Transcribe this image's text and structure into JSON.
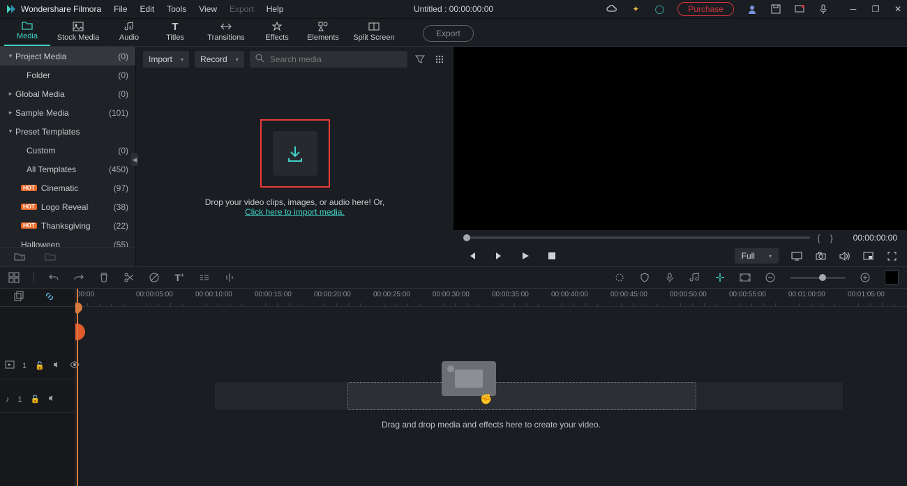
{
  "app": {
    "name": "Wondershare Filmora",
    "title": "Untitled : 00:00:00:00"
  },
  "menu": {
    "file": "File",
    "edit": "Edit",
    "tools": "Tools",
    "view": "View",
    "export": "Export",
    "help": "Help"
  },
  "titlebar": {
    "purchase": "Purchase"
  },
  "modules": {
    "media": "Media",
    "stock": "Stock Media",
    "audio": "Audio",
    "titles": "Titles",
    "transitions": "Transitions",
    "effects": "Effects",
    "elements": "Elements",
    "split": "Split Screen",
    "export": "Export"
  },
  "tree": [
    {
      "label": "Project Media",
      "count": "(0)",
      "sel": true,
      "caret": "▾",
      "ind": 0
    },
    {
      "label": "Folder",
      "count": "(0)",
      "ind": 1
    },
    {
      "label": "Global Media",
      "count": "(0)",
      "caret": "▸",
      "ind": 0
    },
    {
      "label": "Sample Media",
      "count": "(101)",
      "caret": "▸",
      "ind": 0
    },
    {
      "label": "Preset Templates",
      "count": "",
      "caret": "▾",
      "ind": 0
    },
    {
      "label": "Custom",
      "count": "(0)",
      "ind": 1
    },
    {
      "label": "All Templates",
      "count": "(450)",
      "ind": 1
    },
    {
      "label": "Cinematic",
      "count": "(97)",
      "hot": true,
      "ind": 2
    },
    {
      "label": "Logo Reveal",
      "count": "(38)",
      "hot": true,
      "ind": 2
    },
    {
      "label": "Thanksgiving",
      "count": "(22)",
      "hot": true,
      "ind": 2
    },
    {
      "label": "Halloween",
      "count": "(55)",
      "ind": 2
    }
  ],
  "midbar": {
    "import": "Import",
    "record": "Record",
    "search_ph": "Search media"
  },
  "drop": {
    "text": "Drop your video clips, images, or audio here! Or,",
    "link": "Click here to import media."
  },
  "preview": {
    "timecode": "00:00:00:00",
    "quality": "Full",
    "brace_l": "{",
    "brace_r": "}"
  },
  "ruler": [
    "00:00",
    "00:00:05:00",
    "00:00:10:00",
    "00:00:15:00",
    "00:00:20:00",
    "00:00:25:00",
    "00:00:30:00",
    "00:00:35:00",
    "00:00:40:00",
    "00:00:45:00",
    "00:00:50:00",
    "00:00:55:00",
    "00:01:00:00",
    "00:01:05:00",
    "00:01:"
  ],
  "timeline": {
    "hint": "Drag and drop media and effects here to create your video.",
    "track1": "1",
    "track2": "1"
  },
  "hot_label": "HOT"
}
